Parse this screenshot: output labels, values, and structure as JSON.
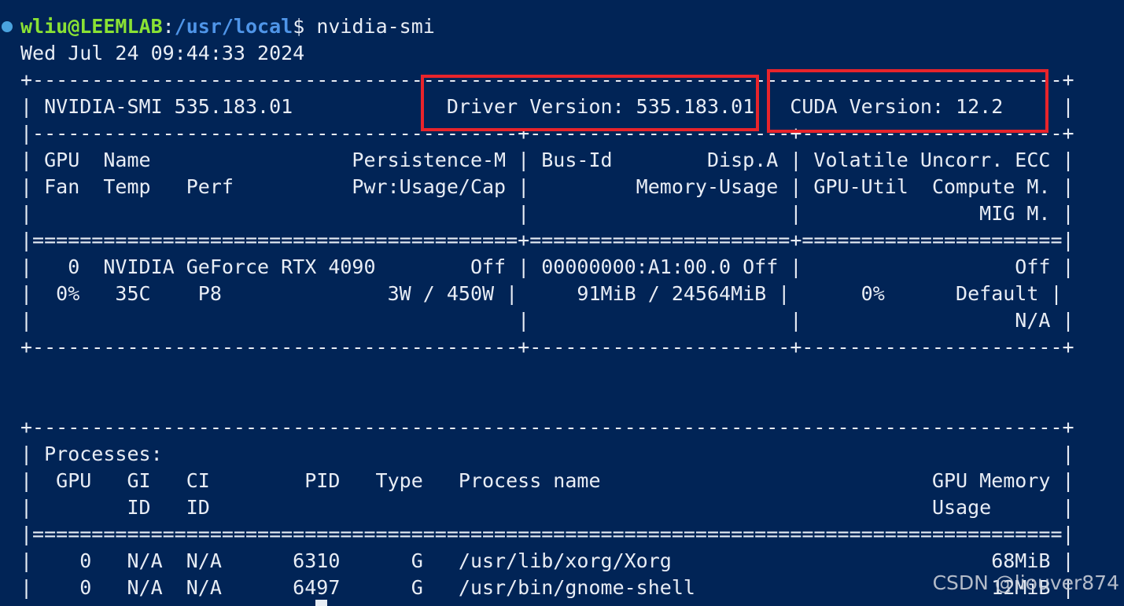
{
  "prompt": {
    "user_host": "wliu@LEEMLAB",
    "separator": ":",
    "path": "/usr/local",
    "symbol": "$",
    "command": " nvidia-smi"
  },
  "output": {
    "timestamp": "Wed Jul 24 09:44:33 2024",
    "smi_lines": [
      "+---------------------------------------------------------------------------------------+",
      "| NVIDIA-SMI 535.183.01             Driver Version: 535.183.01   CUDA Version: 12.2     |",
      "|-----------------------------------------+----------------------+----------------------+",
      "| GPU  Name                 Persistence-M | Bus-Id        Disp.A | Volatile Uncorr. ECC |",
      "| Fan  Temp   Perf          Pwr:Usage/Cap |         Memory-Usage | GPU-Util  Compute M. |",
      "|                                         |                      |               MIG M. |",
      "|=========================================+======================+======================|",
      "|   0  NVIDIA GeForce RTX 4090        Off | 00000000:A1:00.0 Off |                  Off |",
      "|  0%   35C    P8              3W / 450W |     91MiB / 24564MiB |      0%      Default |",
      "|                                         |                      |                  N/A |",
      "+-----------------------------------------+----------------------+----------------------+",
      "",
      "",
      "+---------------------------------------------------------------------------------------+",
      "| Processes:                                                                            |",
      "|  GPU   GI   CI        PID   Type   Process name                            GPU Memory |",
      "|        ID   ID                                                             Usage      |",
      "|=======================================================================================|",
      "|    0   N/A  N/A      6310      G   /usr/lib/xorg/Xorg                           68MiB |",
      "|    0   N/A  N/A      6497      G   /usr/bin/gnome-shell                         12MiB |",
      "+---------------------------------------------------------------------------------------+"
    ]
  },
  "annotations": {
    "highlight_color": "#e8242b"
  },
  "watermark": "CSDN @liouver874"
}
